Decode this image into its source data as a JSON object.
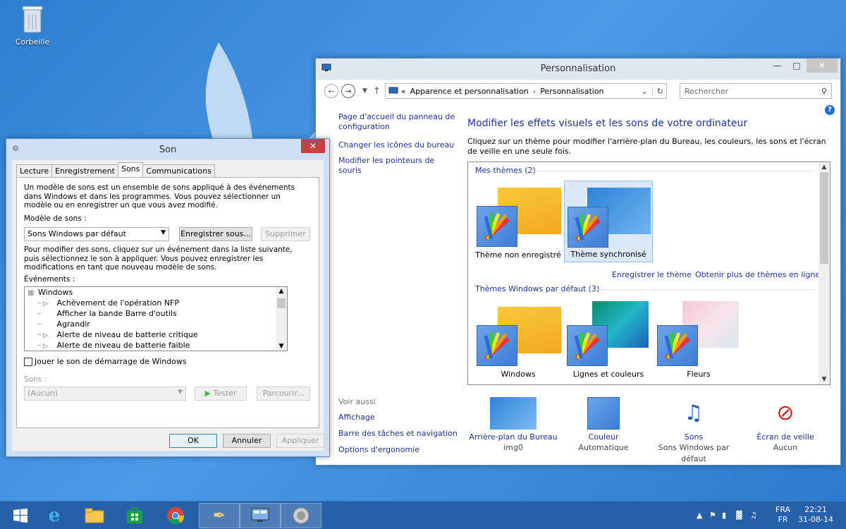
{
  "desktop": {
    "recycle_bin_label": "Corbeille"
  },
  "perso": {
    "title": "Personnalisation",
    "breadcrumb": {
      "prefix": "«",
      "crumb1": "Apparence et personnalisation",
      "crumb2": "Personnalisation"
    },
    "search_placeholder": "Rechercher",
    "left_nav": {
      "home": "Page d'accueil du panneau de configuration",
      "icons": "Changer les icônes du bureau",
      "pointers": "Modifier les pointeurs de souris"
    },
    "see_also": {
      "header": "Voir aussi",
      "display": "Affichage",
      "taskbar": "Barre des tâches et navigation",
      "ergonomics": "Options d'ergonomie"
    },
    "heading": "Modifier les effets visuels et les sons de votre ordinateur",
    "description": "Cliquez sur un thème pour modifier l'arrière-plan du Bureau, les couleurs, les sons et l'écran de veille en une seule fois.",
    "my_themes_header": "Mes thèmes (2)",
    "my_themes": [
      {
        "name": "Thème non enregistré"
      },
      {
        "name": "Thème synchronisé"
      }
    ],
    "save_theme_link": "Enregistrer le thème",
    "more_themes_link": "Obtenir plus de thèmes en ligne",
    "default_themes_header": "Thèmes Windows par défaut (3)",
    "default_themes": [
      {
        "name": "Windows"
      },
      {
        "name": "Lignes et couleurs"
      },
      {
        "name": "Fleurs"
      }
    ],
    "bottom": {
      "wallpaper": {
        "label": "Arrière-plan du Bureau",
        "value": "img0"
      },
      "color": {
        "label": "Couleur",
        "value": "Automatique"
      },
      "sounds": {
        "label": "Sons",
        "value": "Sons Windows par défaut"
      },
      "screensaver": {
        "label": "Écran de veille",
        "value": "Aucun"
      }
    }
  },
  "son": {
    "title": "Son",
    "tabs": [
      "Lecture",
      "Enregistrement",
      "Sons",
      "Communications"
    ],
    "intro": "Un modèle de sons est un ensemble de sons appliqué à des événements dans Windows et dans les programmes. Vous pouvez sélectionner un modèle ou en enregistrer un que vous avez modifié.",
    "scheme_label": "Modèle de sons :",
    "scheme_value": "Sons Windows par défaut",
    "save_as": "Enregistrer sous...",
    "delete": "Supprimer",
    "instructions": "Pour modifier des sons, cliquez sur un événement dans la liste suivante, puis sélectionnez le son à appliquer. Vous pouvez enregistrer les modifications en tant que nouveau modèle de sons.",
    "events_label": "Événements :",
    "events": {
      "root": "Windows",
      "items": [
        "Achèvement de l'opération NFP",
        "Afficher la bande Barre d'outils",
        "Agrandir",
        "Alerte de niveau de batterie critique",
        "Alerte de niveau de batterie faible"
      ]
    },
    "startup_checkbox": "Jouer le son de démarrage de Windows",
    "sounds_label": "Sons :",
    "sound_value": "(Aucun)",
    "test": "Tester",
    "browse": "Parcourir...",
    "ok": "OK",
    "cancel": "Annuler",
    "apply": "Appliquer"
  },
  "tray": {
    "lang_top": "FRA",
    "lang_bottom": "FR",
    "time": "22:21",
    "date": "31-08-14"
  },
  "colors": {
    "accent": "#1e3287",
    "desktop": "#3b88d9",
    "taskbar": "#2660a6"
  }
}
